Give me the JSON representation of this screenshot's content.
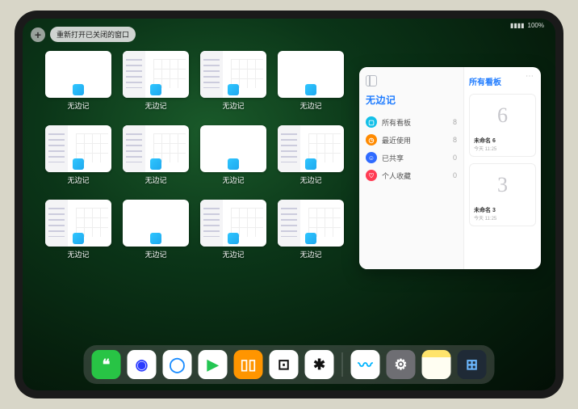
{
  "status": {
    "battery": "100%",
    "signal": "▮▮▮▮"
  },
  "topbar": {
    "plus": "+",
    "reopen": "重新打开已关闭的窗口"
  },
  "windows": [
    {
      "label": "无边记",
      "variant": "blank"
    },
    {
      "label": "无边记",
      "variant": "sidebar"
    },
    {
      "label": "无边记",
      "variant": "sidebar"
    },
    {
      "label": "无边记",
      "variant": "blank"
    },
    {
      "label": "无边记",
      "variant": "sidebar"
    },
    {
      "label": "无边记",
      "variant": "sidebar"
    },
    {
      "label": "无边记",
      "variant": "blank"
    },
    {
      "label": "无边记",
      "variant": "sidebar"
    },
    {
      "label": "无边记",
      "variant": "sidebar"
    },
    {
      "label": "无边记",
      "variant": "blank"
    },
    {
      "label": "无边记",
      "variant": "sidebar"
    },
    {
      "label": "无边记",
      "variant": "sidebar"
    }
  ],
  "panel": {
    "title": "无边记",
    "categories": [
      {
        "label": "所有看板",
        "count": "8",
        "color": "#14c0e8",
        "glyph": "▢"
      },
      {
        "label": "最近使用",
        "count": "8",
        "color": "#ff8a00",
        "glyph": "◷"
      },
      {
        "label": "已共享",
        "count": "0",
        "color": "#2f6bff",
        "glyph": "☺"
      },
      {
        "label": "个人收藏",
        "count": "0",
        "color": "#ff3b53",
        "glyph": "♡"
      }
    ],
    "right_title": "所有看板",
    "boards": [
      {
        "preview": "6",
        "title": "未命名 6",
        "date": "今天 11:25"
      },
      {
        "preview": "3",
        "title": "未命名 3",
        "date": "今天 11:25"
      }
    ]
  },
  "dock": [
    {
      "name": "wechat",
      "bg": "#28c445",
      "glyph": "❝"
    },
    {
      "name": "browser1",
      "bg": "#ffffff",
      "glyph": "◉",
      "fg": "#2b3bff"
    },
    {
      "name": "browser2",
      "bg": "#ffffff",
      "glyph": "◯",
      "fg": "#1a8cff"
    },
    {
      "name": "play",
      "bg": "#ffffff",
      "glyph": "▶",
      "fg": "#23c552"
    },
    {
      "name": "books",
      "bg": "#ff9500",
      "glyph": "▯▯"
    },
    {
      "name": "dice",
      "bg": "#ffffff",
      "glyph": "⊡",
      "fg": "#111"
    },
    {
      "name": "dots",
      "bg": "#ffffff",
      "glyph": "✱",
      "fg": "#111"
    },
    {
      "name": "freeform",
      "bg": "#ffffff",
      "glyph": "〰",
      "fg": "#00b4ff"
    },
    {
      "name": "settings",
      "bg": "#6e6e73",
      "glyph": "⚙"
    },
    {
      "name": "notes",
      "bg": "linear-gradient(#ffe46b 25%, #fffef2 25%)",
      "glyph": ""
    },
    {
      "name": "folder",
      "bg": "#1f2a36",
      "glyph": "⊞",
      "fg": "#6cb8ff"
    }
  ]
}
